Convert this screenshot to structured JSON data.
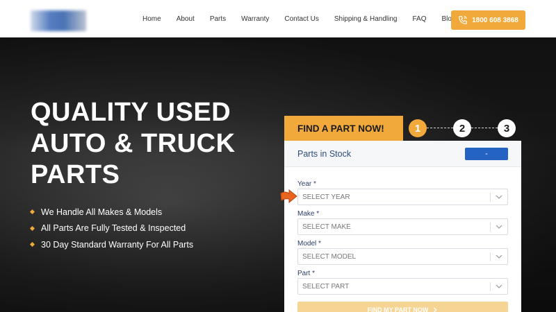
{
  "header": {
    "logo_alt": "logo",
    "nav": [
      "Home",
      "About",
      "Parts",
      "Warranty",
      "Contact Us",
      "Shipping & Handling",
      "FAQ",
      "Blog"
    ],
    "phone": "1800 608 3868"
  },
  "hero": {
    "headline": [
      "QUALITY USED",
      "AUTO & TRUCK",
      "PARTS"
    ],
    "features": [
      "We Handle All Makes & Models",
      "All Parts Are Fully Tested & Inspected",
      "30 Day Standard Warranty For All Parts"
    ]
  },
  "finder": {
    "tab_label": "FIND A PART NOW!",
    "steps": [
      "1",
      "2",
      "3"
    ],
    "active_step": 1,
    "stock_label": "Parts in Stock",
    "stock_value": "-",
    "fields": [
      {
        "label": "Year *",
        "placeholder": "SELECT YEAR"
      },
      {
        "label": "Make *",
        "placeholder": "SELECT MAKE"
      },
      {
        "label": "Model *",
        "placeholder": "SELECT MODEL"
      },
      {
        "label": "Part *",
        "placeholder": "SELECT PART"
      }
    ],
    "submit_label": "FIND MY PART NOW"
  },
  "colors": {
    "accent": "#f1a93b",
    "badge_blue": "#2563c2",
    "label_navy": "#2a3d66"
  }
}
